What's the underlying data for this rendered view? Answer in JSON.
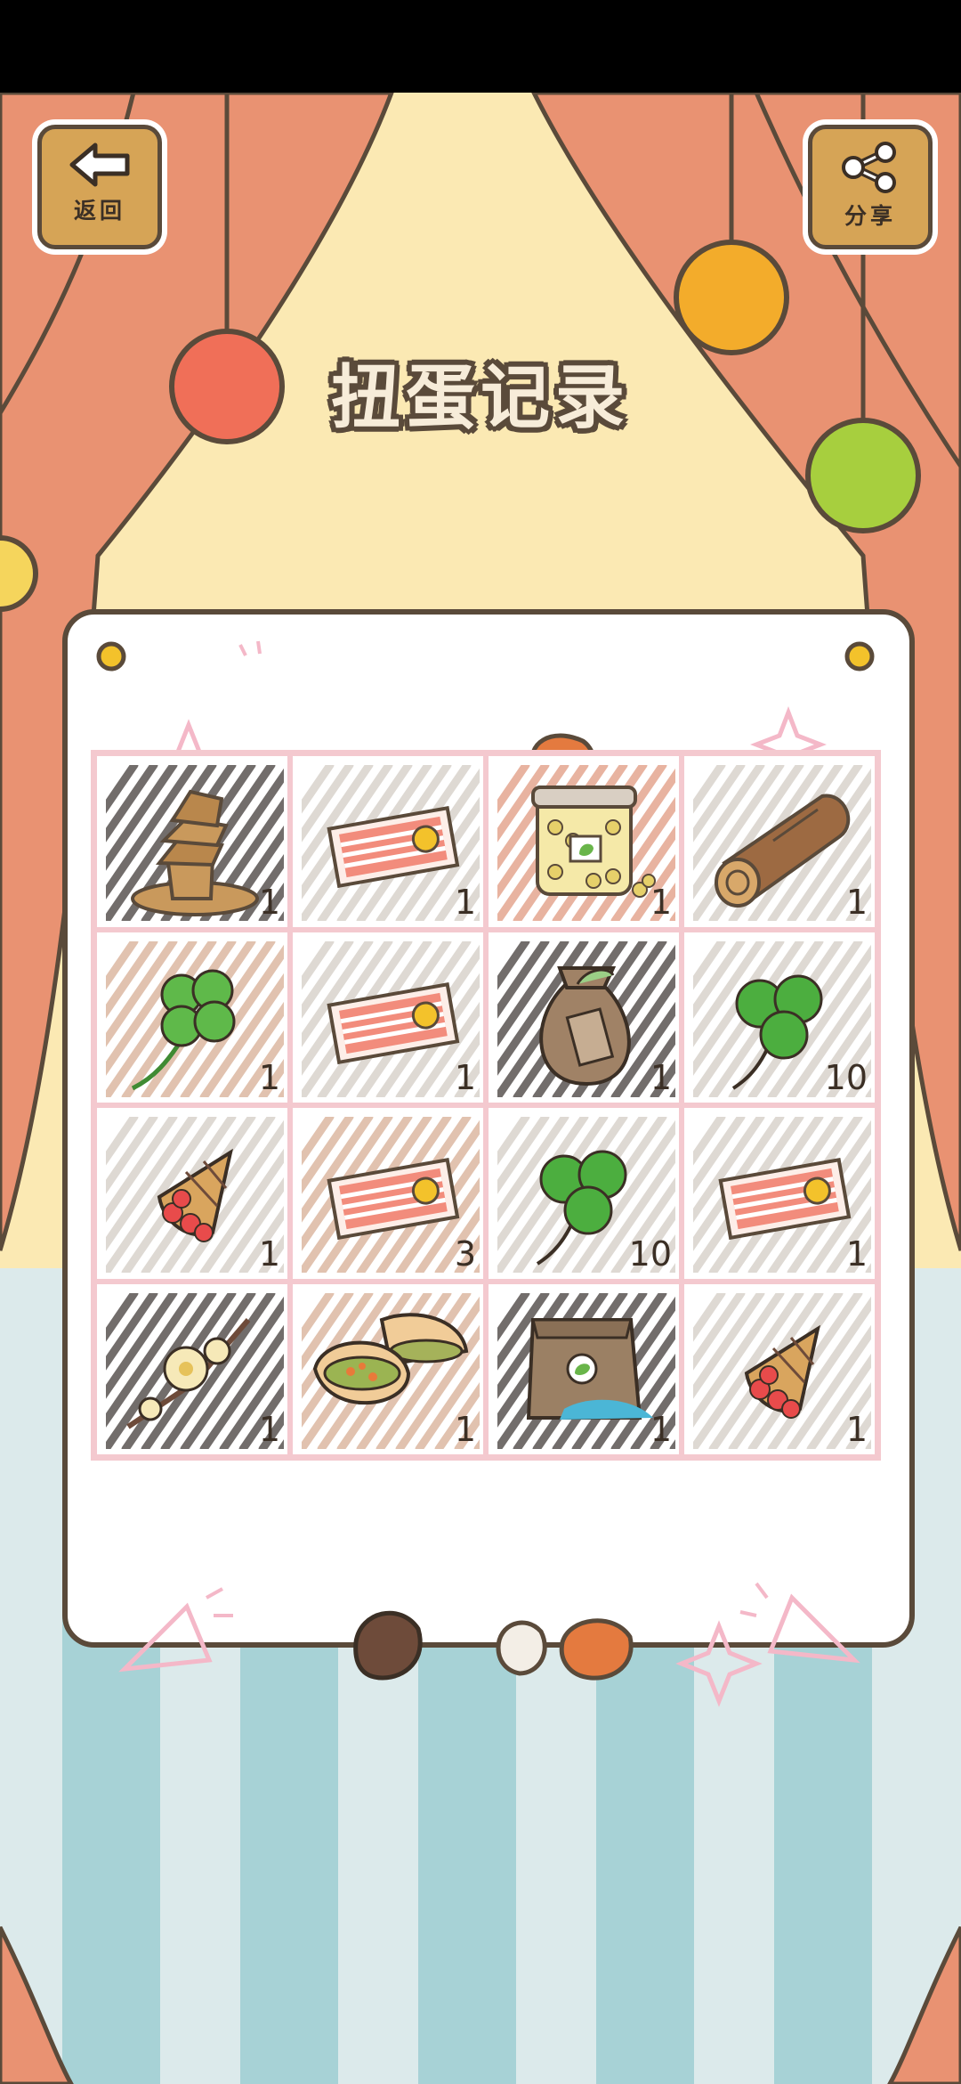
{
  "header": {
    "title": "扭蛋记录"
  },
  "back_button": {
    "label": "返回",
    "icon": "arrow-left-icon"
  },
  "share_button": {
    "label": "分享",
    "icon": "share-icon"
  },
  "items": [
    {
      "name": "wooden-stack",
      "count": "1",
      "hatch": "#5a5452"
    },
    {
      "name": "ticket",
      "count": "1",
      "hatch": "#d9d3cc"
    },
    {
      "name": "bean-jar",
      "count": "1",
      "hatch": "#e4a690"
    },
    {
      "name": "log",
      "count": "1",
      "hatch": "#d9d3cc"
    },
    {
      "name": "four-leaf-clover",
      "count": "1",
      "hatch": "#dcb8a2"
    },
    {
      "name": "ticket",
      "count": "1",
      "hatch": "#d9d3cc"
    },
    {
      "name": "seed-bag",
      "count": "1",
      "hatch": "#5a5452"
    },
    {
      "name": "clover",
      "count": "10",
      "hatch": "#d9d3cc"
    },
    {
      "name": "crepe",
      "count": "1",
      "hatch": "#d9d3cc"
    },
    {
      "name": "ticket",
      "count": "3",
      "hatch": "#dcb8a2"
    },
    {
      "name": "clover",
      "count": "10",
      "hatch": "#d9d3cc"
    },
    {
      "name": "ticket",
      "count": "1",
      "hatch": "#d9d3cc"
    },
    {
      "name": "plum-blossom",
      "count": "1",
      "hatch": "#5a5452"
    },
    {
      "name": "pita-bread",
      "count": "1",
      "hatch": "#dcb8a2"
    },
    {
      "name": "fertilizer-bag",
      "count": "1",
      "hatch": "#5a5452"
    },
    {
      "name": "crepe",
      "count": "1",
      "hatch": "#d9d3cc"
    }
  ],
  "colors": {
    "curtain": "#e99272",
    "wall": "#fbe9b3",
    "stripe_light": "#dceaeb",
    "stripe_dark": "#a7d2d6",
    "outline": "#5a4a3a",
    "grid_border": "#f4c9cf"
  }
}
